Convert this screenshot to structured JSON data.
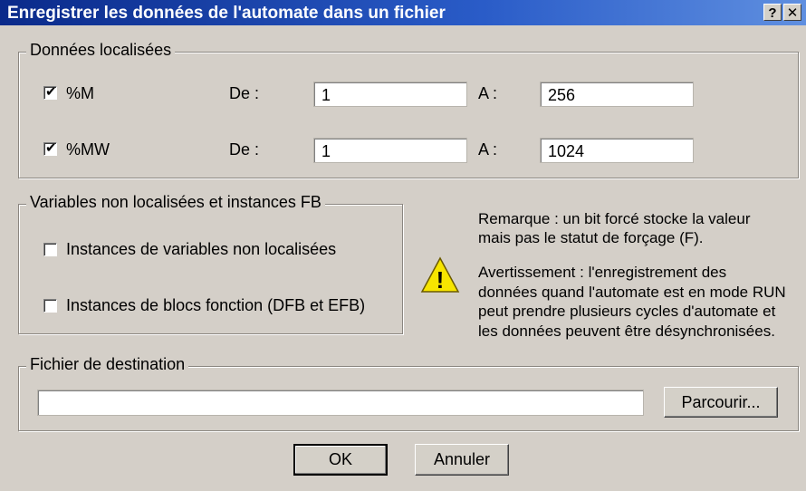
{
  "window": {
    "title": "Enregistrer les données de l'automate dans un fichier",
    "help_label": "?",
    "close_label": "✕"
  },
  "located": {
    "legend": "Données localisées",
    "rows": [
      {
        "checked": true,
        "label": "%M",
        "from_label": "De :",
        "from_value": "1",
        "to_label": "A :",
        "to_value": "256"
      },
      {
        "checked": true,
        "label": "%MW",
        "from_label": "De :",
        "from_value": "1",
        "to_label": "A :",
        "to_value": "1024"
      }
    ]
  },
  "unlocated": {
    "legend": "Variables non localisées et instances FB",
    "options": [
      {
        "checked": false,
        "label": "Instances de variables non localisées"
      },
      {
        "checked": false,
        "label": "Instances de blocs fonction (DFB et EFB)"
      }
    ]
  },
  "notes": {
    "remark": "Remarque : un bit forcé stocke la valeur mais pas le statut de forçage (F).",
    "warning": "Avertissement : l'enregistrement des données quand l'automate est en mode RUN peut prendre plusieurs cycles d'automate et les données peuvent être désynchronisées.",
    "warning_icon": "warning-icon",
    "warning_glyph": "!"
  },
  "destination": {
    "legend": "Fichier de destination",
    "path_value": "",
    "browse_label": "Parcourir..."
  },
  "actions": {
    "ok_label": "OK",
    "cancel_label": "Annuler"
  },
  "check_glyph": "✔"
}
